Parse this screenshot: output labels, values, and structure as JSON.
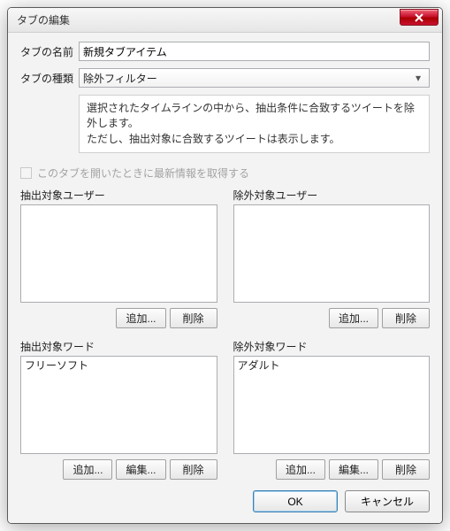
{
  "window": {
    "title": "タブの編集"
  },
  "form": {
    "name_label": "タブの名前",
    "name_value": "新規タブアイテム",
    "type_label": "タブの種類",
    "type_value": "除外フィルター",
    "description": "選択されたタイムラインの中から、抽出条件に合致するツイートを除外します。\nただし、抽出対象に合致するツイートは表示します。",
    "refresh_label": "このタブを開いたときに最新情報を取得する"
  },
  "groups": {
    "extract_user": {
      "title": "抽出対象ユーザー",
      "items": []
    },
    "exclude_user": {
      "title": "除外対象ユーザー",
      "items": []
    },
    "extract_word": {
      "title": "抽出対象ワード",
      "items": [
        "フリーソフト"
      ]
    },
    "exclude_word": {
      "title": "除外対象ワード",
      "items": [
        "アダルト"
      ]
    }
  },
  "buttons": {
    "add": "追加...",
    "edit": "編集...",
    "delete": "削除",
    "ok": "OK",
    "cancel": "キャンセル"
  }
}
